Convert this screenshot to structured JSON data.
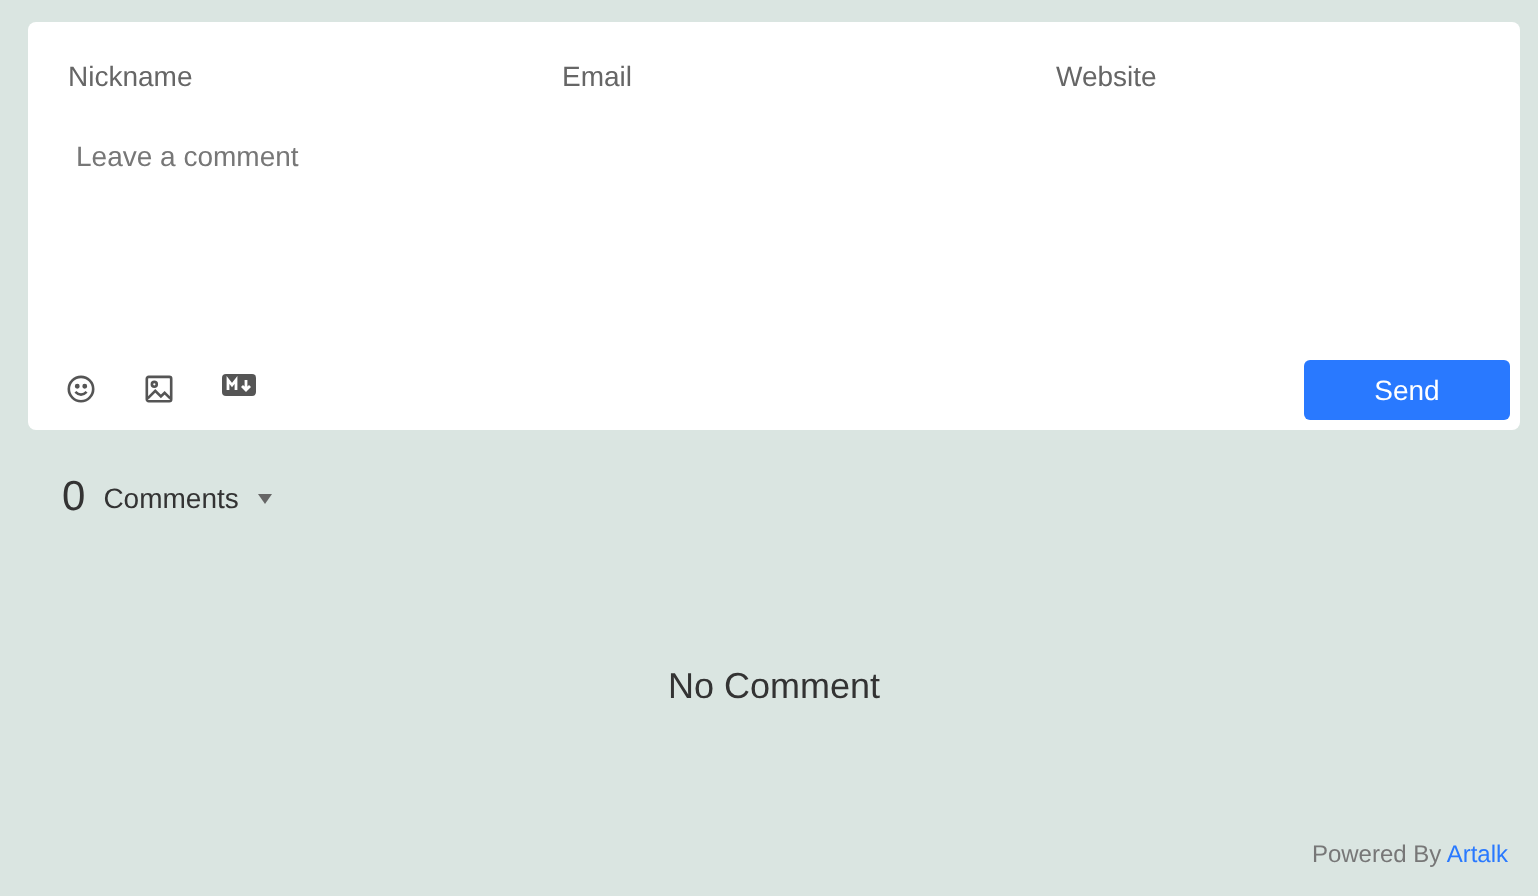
{
  "form": {
    "fields": [
      {
        "placeholder": "Nickname"
      },
      {
        "placeholder": "Email"
      },
      {
        "placeholder": "Website"
      }
    ],
    "comment": {
      "placeholder": "Leave a comment"
    },
    "tools": [
      {
        "kind": "emoji"
      },
      {
        "kind": "image"
      },
      {
        "kind": "markdown"
      }
    ],
    "send": "Send"
  },
  "count": {
    "number": "0",
    "label": "Comments",
    "expanded": true
  },
  "empty": "No Comment",
  "footer": {
    "text": "Powered By",
    "link": "Artalk"
  }
}
